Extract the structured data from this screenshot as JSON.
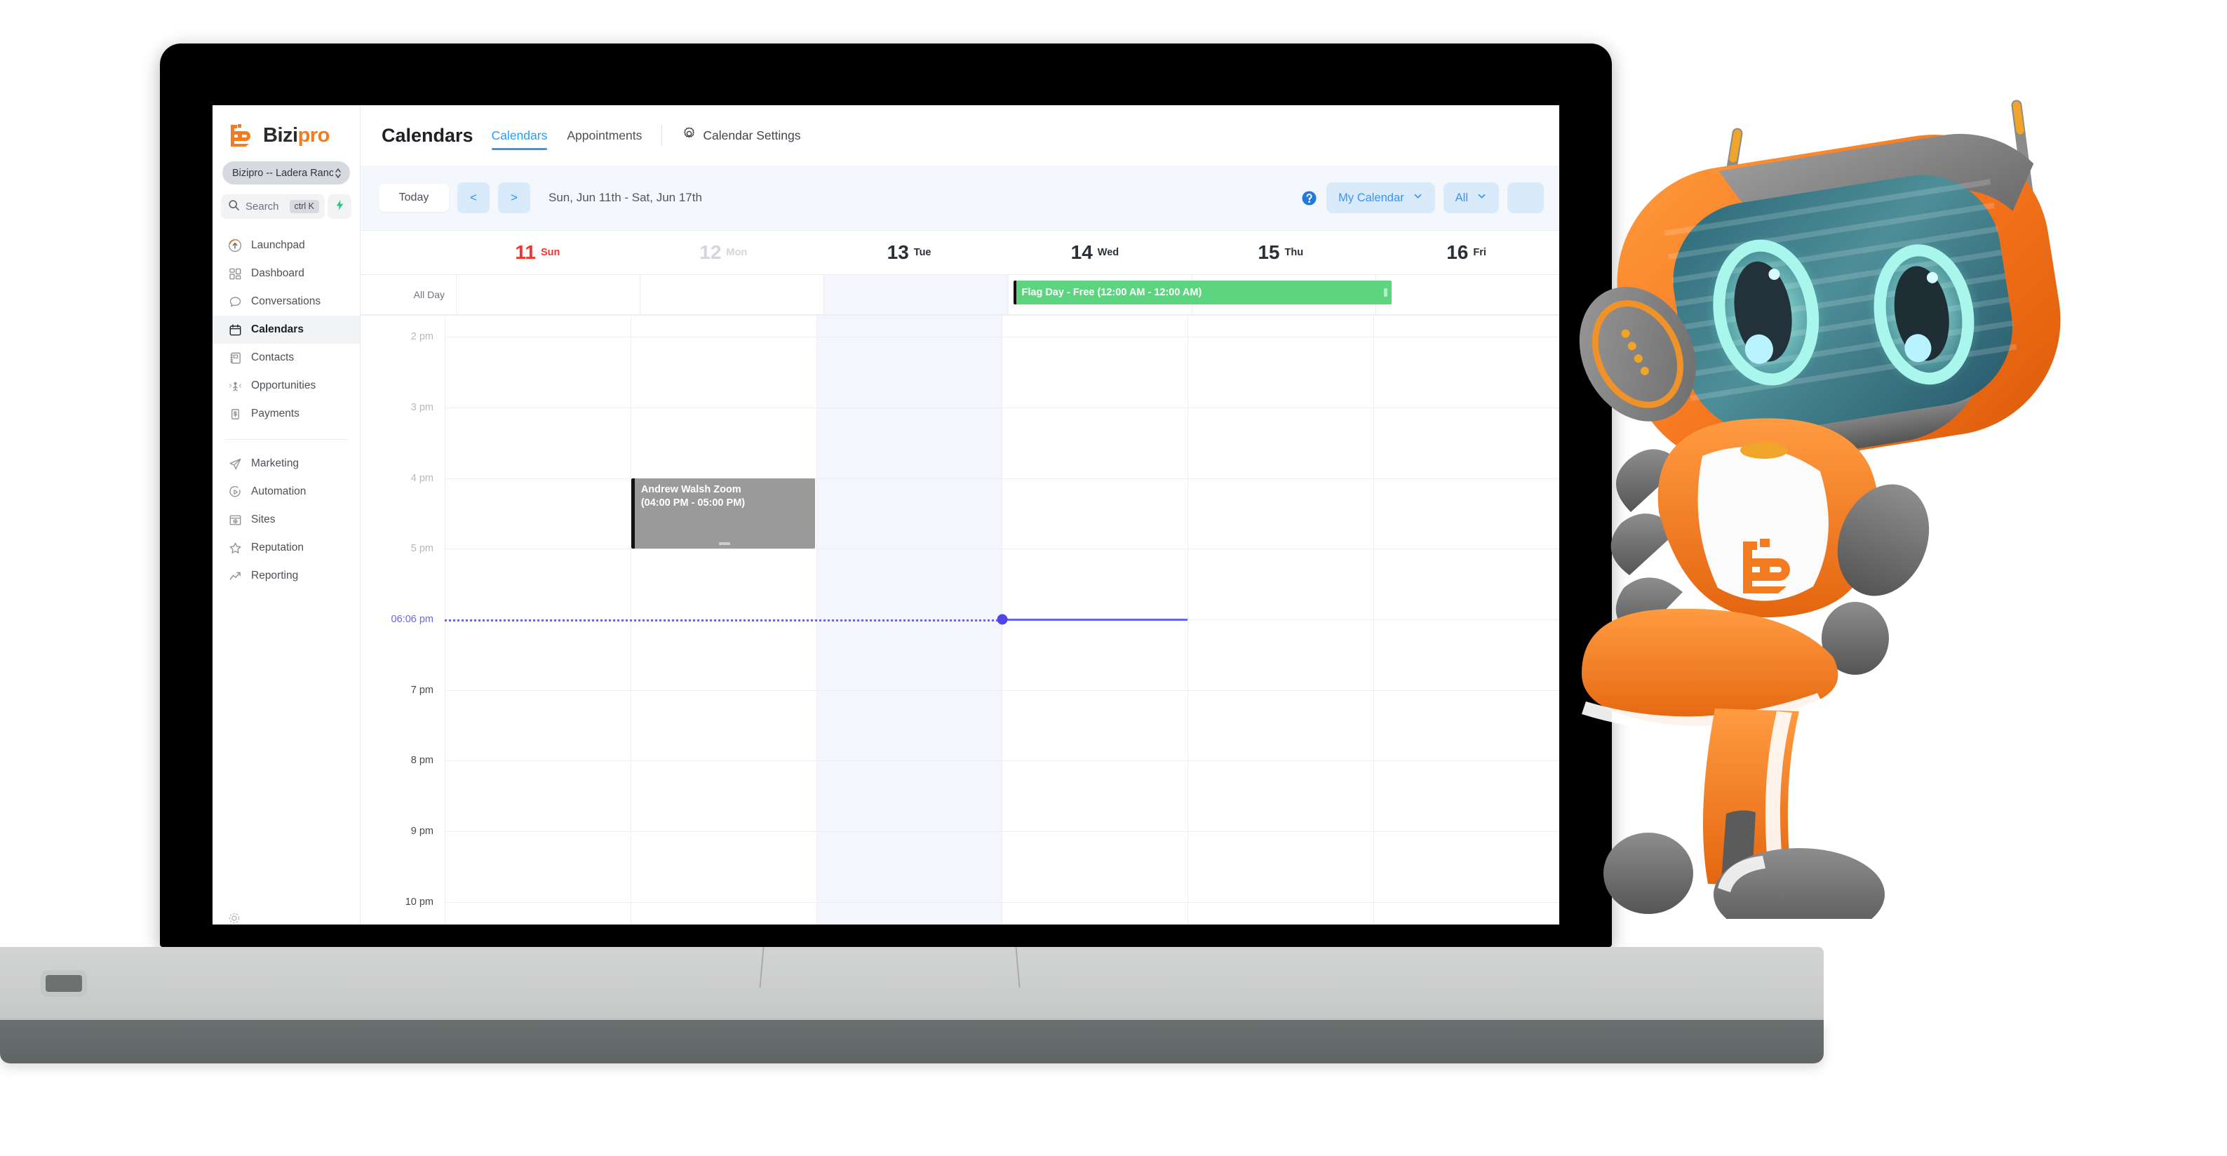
{
  "brand": {
    "logo_text_part1": "Bizi",
    "logo_text_part2": "pro",
    "orange": "#f57b20",
    "accent_blue": "#2d9cf0"
  },
  "sidebar": {
    "account_selector": {
      "label": "Bizipro -- Ladera Ranch , ...",
      "icon": "chevron-updown-icon"
    },
    "search": {
      "placeholder": "Search",
      "shortcut": "ctrl K",
      "icon": "search-icon",
      "bolt_icon": "lightning-bolt-icon",
      "bolt_color": "#2bc87e"
    },
    "primary_items": [
      {
        "label": "Launchpad",
        "icon": "rocket-launchpad-icon",
        "active": false
      },
      {
        "label": "Dashboard",
        "icon": "dashboard-grid-icon",
        "active": false
      },
      {
        "label": "Conversations",
        "icon": "chat-bubble-icon",
        "active": false
      },
      {
        "label": "Calendars",
        "icon": "calendar-icon",
        "active": true
      },
      {
        "label": "Contacts",
        "icon": "contact-book-icon",
        "active": false
      },
      {
        "label": "Opportunities",
        "icon": "opportunities-icon",
        "active": false
      },
      {
        "label": "Payments",
        "icon": "payments-dollar-icon",
        "active": false
      }
    ],
    "secondary_items": [
      {
        "label": "Marketing",
        "icon": "paper-plane-icon",
        "active": false
      },
      {
        "label": "Automation",
        "icon": "play-circle-icon",
        "active": false
      },
      {
        "label": "Sites",
        "icon": "browser-window-icon",
        "active": false
      },
      {
        "label": "Reputation",
        "icon": "star-icon",
        "active": false
      },
      {
        "label": "Reporting",
        "icon": "trending-up-icon",
        "active": false
      }
    ]
  },
  "header": {
    "title": "Calendars",
    "tabs": [
      {
        "label": "Calendars",
        "active": true
      },
      {
        "label": "Appointments",
        "active": false
      }
    ],
    "settings_label": "Calendar Settings",
    "settings_icon": "gear-icon"
  },
  "toolbar": {
    "today_label": "Today",
    "prev_label": "<",
    "next_label": ">",
    "range_label": "Sun, Jun 11th - Sat, Jun 17th",
    "help_icon": "help-circle-icon",
    "calendar_filter": {
      "label": "My Calendar",
      "icon": "chevron-down-icon"
    },
    "user_filter": {
      "label": "All",
      "icon": "chevron-down-icon"
    }
  },
  "calendar": {
    "all_day_label": "All Day",
    "days": [
      {
        "num": "11",
        "dow": "Sun",
        "state": "today"
      },
      {
        "num": "12",
        "dow": "Mon",
        "state": "dim"
      },
      {
        "num": "13",
        "dow": "Tue",
        "state": "norm"
      },
      {
        "num": "14",
        "dow": "Wed",
        "state": "norm"
      },
      {
        "num": "15",
        "dow": "Thu",
        "state": "norm"
      },
      {
        "num": "16",
        "dow": "Fri",
        "state": "norm"
      }
    ],
    "time_labels": [
      {
        "text": "2 pm",
        "style": "dim"
      },
      {
        "text": "3 pm",
        "style": "dim"
      },
      {
        "text": "4 pm",
        "style": "dim"
      },
      {
        "text": "5 pm",
        "style": "dim"
      },
      {
        "text": "06:06 pm",
        "style": "now"
      },
      {
        "text": "7 pm",
        "style": "dark"
      },
      {
        "text": "8 pm",
        "style": "dark"
      },
      {
        "text": "9 pm",
        "style": "dark"
      },
      {
        "text": "10 pm",
        "style": "dark"
      }
    ],
    "all_day_event": {
      "title": "Flag Day - Free (12:00 AM - 12:00 AM)",
      "color": "#5dd47f"
    },
    "event": {
      "title": "Andrew Walsh Zoom",
      "time": "(04:00 PM - 05:00 PM)",
      "color": "#9a9a9a"
    },
    "current_time": "06:06 pm",
    "current_time_color": "#6366f1"
  }
}
